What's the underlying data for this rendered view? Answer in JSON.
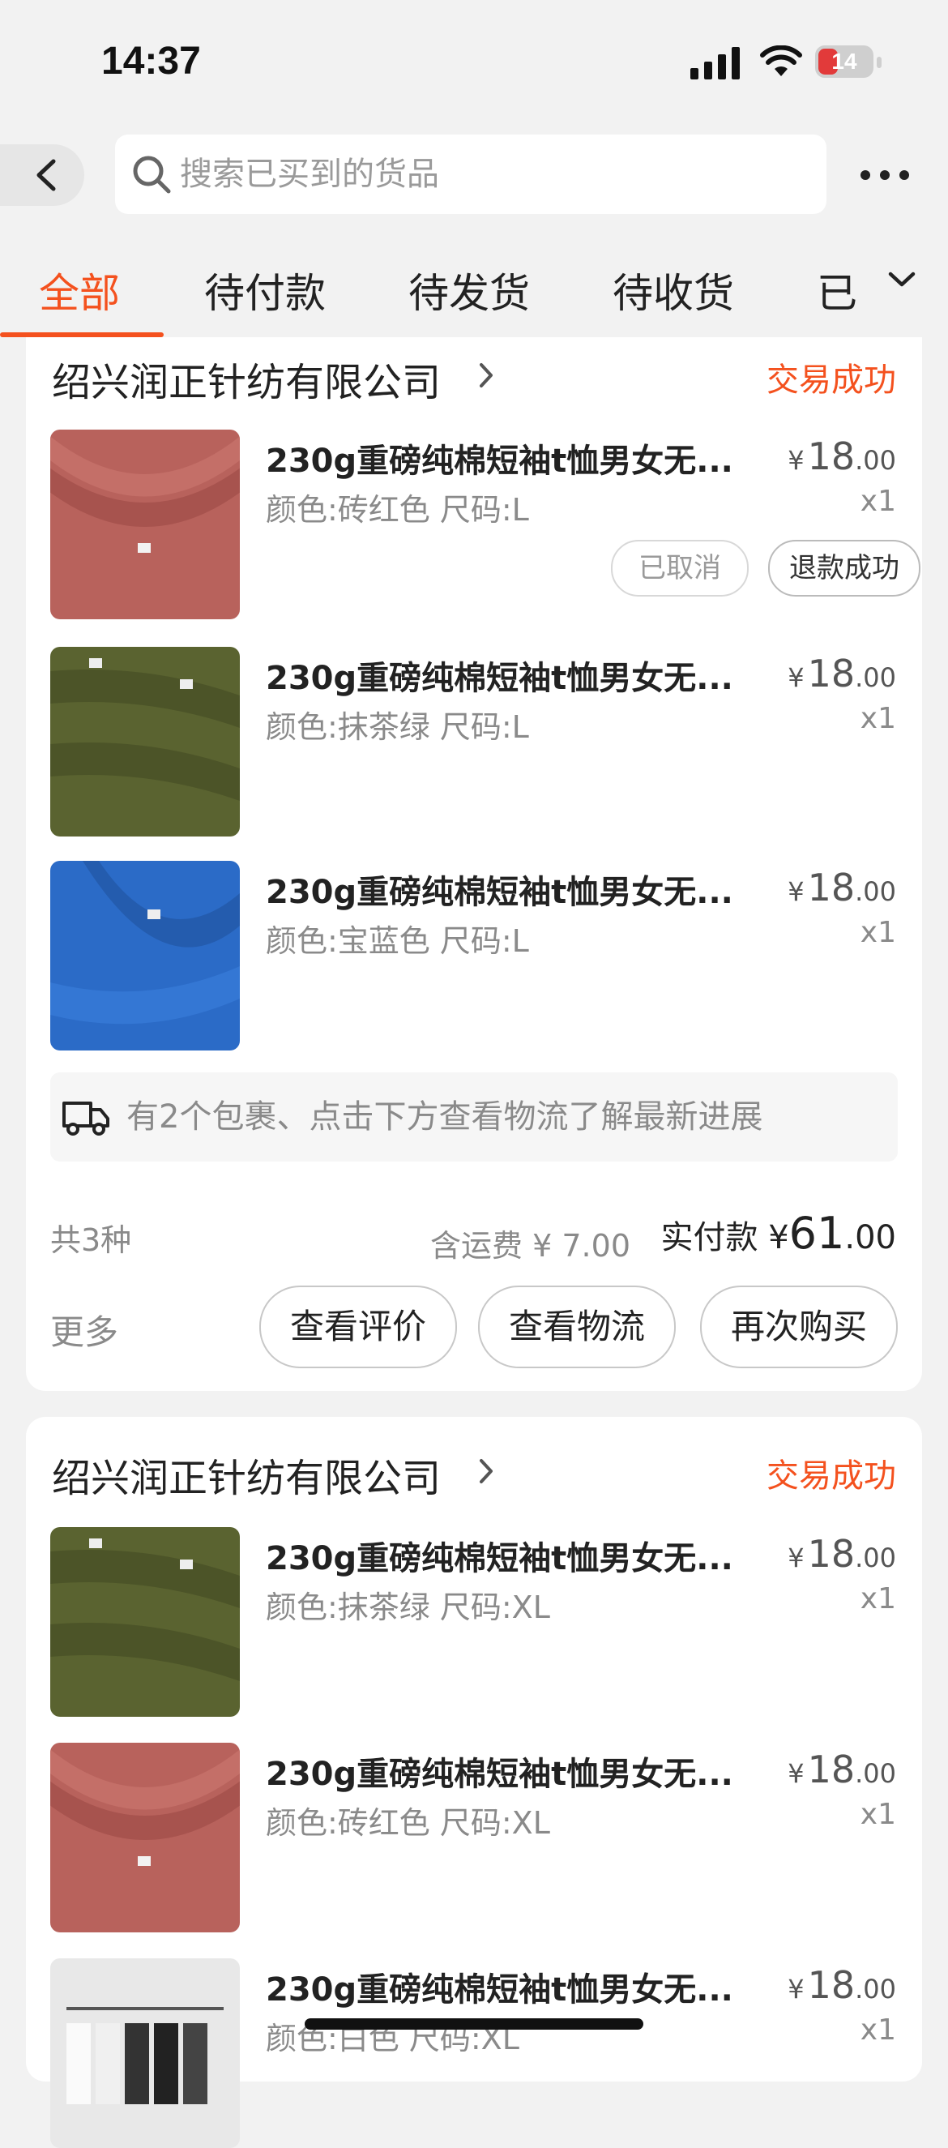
{
  "status_bar": {
    "time": "14:37",
    "battery": "14"
  },
  "header": {
    "search_placeholder": "搜索已买到的货品"
  },
  "tabs": [
    {
      "label": "全部",
      "active": true
    },
    {
      "label": "待付款",
      "active": false
    },
    {
      "label": "待发货",
      "active": false
    },
    {
      "label": "待收货",
      "active": false
    },
    {
      "label": "已",
      "active": false
    }
  ],
  "orders": [
    {
      "shop": "绍兴润正针纺有限公司",
      "status": "交易成功",
      "items": [
        {
          "title": "230g重磅纯棉短袖t恤男女无...",
          "spec": "颜色:砖红色 尺码:L",
          "currency": "¥",
          "price_int": "18",
          "price_dec": ".00",
          "qty": "x1",
          "tags": [
            "已取消",
            "退款成功"
          ],
          "color": "#b8625c"
        },
        {
          "title": "230g重磅纯棉短袖t恤男女无...",
          "spec": "颜色:抹茶绿 尺码:L",
          "currency": "¥",
          "price_int": "18",
          "price_dec": ".00",
          "qty": "x1",
          "color": "#5a6330"
        },
        {
          "title": "230g重磅纯棉短袖t恤男女无...",
          "spec": "颜色:宝蓝色 尺码:L",
          "currency": "¥",
          "price_int": "18",
          "price_dec": ".00",
          "qty": "x1",
          "color": "#2b6bc7"
        }
      ],
      "logistics": "有2个包裹、点击下方查看物流了解最新进展",
      "summary": {
        "count": "共3种",
        "shipping": "含运费 ¥ 7.00",
        "paid_label": "实付款",
        "currency": "¥",
        "paid_int": "61",
        "paid_dec": ".00"
      },
      "more": "更多",
      "actions": [
        "查看评价",
        "查看物流",
        "再次购买"
      ]
    },
    {
      "shop": "绍兴润正针纺有限公司",
      "status": "交易成功",
      "items": [
        {
          "title": "230g重磅纯棉短袖t恤男女无...",
          "spec": "颜色:抹茶绿 尺码:XL",
          "currency": "¥",
          "price_int": "18",
          "price_dec": ".00",
          "qty": "x1",
          "color": "#5a6330"
        },
        {
          "title": "230g重磅纯棉短袖t恤男女无...",
          "spec": "颜色:砖红色 尺码:XL",
          "currency": "¥",
          "price_int": "18",
          "price_dec": ".00",
          "qty": "x1",
          "color": "#b8625c"
        },
        {
          "title": "230g重磅纯棉短袖t恤男女无...",
          "spec": "颜色:白色 尺码:XL",
          "currency": "¥",
          "price_int": "18",
          "price_dec": ".00",
          "qty": "x1",
          "color": "#d8d8d8"
        }
      ]
    }
  ]
}
